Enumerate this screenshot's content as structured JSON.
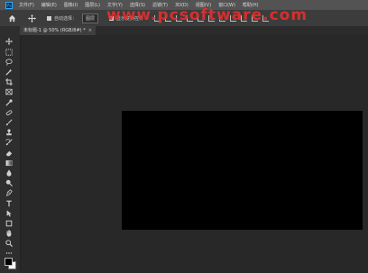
{
  "menubar": {
    "items": [
      "文件(F)",
      "编辑(E)",
      "图像(I)",
      "图层(L)",
      "文字(Y)",
      "选择(S)",
      "滤镜(T)",
      "3D(D)",
      "视图(V)",
      "窗口(W)",
      "帮助(H)"
    ]
  },
  "options": {
    "auto_select_label": "自动选择：",
    "auto_select_value": "图层",
    "show_transform_label": "显示变换控件"
  },
  "document_tab": {
    "title": "未标题-1 @ 50% (RGB/8#) *",
    "close_glyph": "×"
  },
  "toolbar": {
    "tools": [
      "move-tool",
      "marquee-tool",
      "lasso-tool",
      "magic-wand-tool",
      "crop-tool",
      "frame-tool",
      "eyedropper-tool",
      "spot-healing-tool",
      "brush-tool",
      "clone-stamp-tool",
      "history-brush-tool",
      "eraser-tool",
      "gradient-tool",
      "blur-tool",
      "dodge-tool",
      "pen-tool",
      "type-tool",
      "path-selection-tool",
      "rectangle-tool",
      "hand-tool",
      "zoom-tool",
      "more-tools"
    ],
    "foreground_color": "#000000",
    "background_color": "#ffffff"
  },
  "canvas": {
    "fill_color": "#000000",
    "zoom": "50%"
  }
}
